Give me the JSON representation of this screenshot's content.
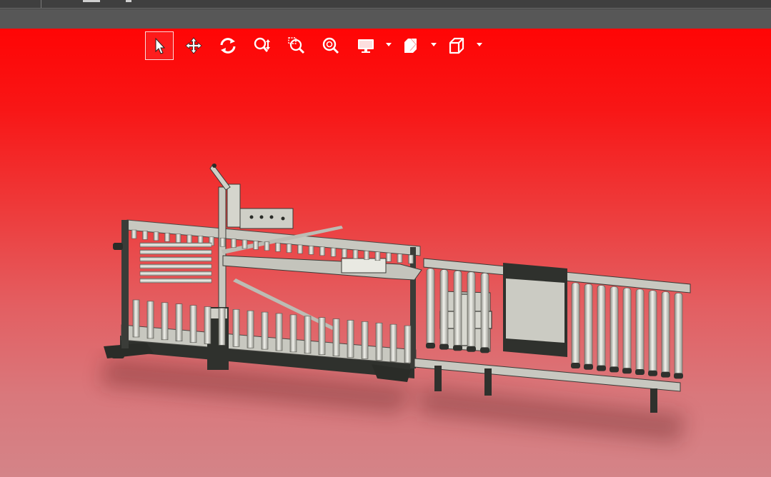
{
  "window": {
    "top_strip_divider_count": 1
  },
  "viewport": {
    "background_top": "#ff0505",
    "background_bottom": "#d48488"
  },
  "toolbar": {
    "tools": [
      {
        "name": "select",
        "icon": "cursor-arrow-icon",
        "active": true
      },
      {
        "name": "pan",
        "icon": "move-arrows-icon",
        "active": false
      },
      {
        "name": "rotate",
        "icon": "rotate-icon",
        "active": false
      },
      {
        "name": "zoom",
        "icon": "zoom-icon",
        "active": false
      },
      {
        "name": "zoom-window",
        "icon": "zoom-window-icon",
        "active": false
      },
      {
        "name": "zoom-fit",
        "icon": "zoom-fit-icon",
        "active": false
      },
      {
        "name": "display-mode",
        "icon": "monitor-icon",
        "active": false,
        "dropdown": true
      },
      {
        "name": "section-view",
        "icon": "section-cube-icon",
        "active": false,
        "dropdown": true
      },
      {
        "name": "view-orientation",
        "icon": "cube-icon",
        "active": false,
        "dropdown": true
      }
    ],
    "icon_color": "#ffffff"
  },
  "model": {
    "description_icon": "conveyor-assembly-3d-model",
    "frame_color": "#bdbdb5",
    "dark_color": "#2f312d"
  }
}
